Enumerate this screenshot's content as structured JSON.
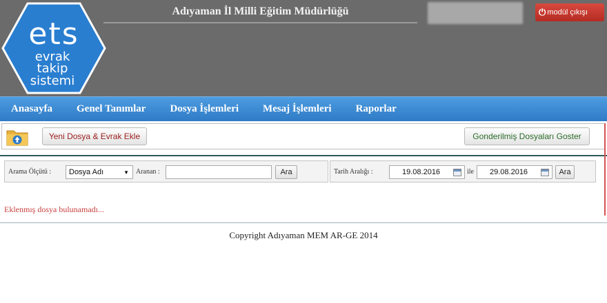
{
  "header": {
    "title": "Adıyaman İl Milli Eğitim Müdürlüğü",
    "logo_text": [
      "ets",
      "evrak",
      "takip",
      "sistemi"
    ],
    "exit_label": "modül çıkışı",
    "exit_icon": "power-icon"
  },
  "nav": {
    "items": [
      "Anasayfa",
      "Genel Tanımlar",
      "Dosya İşlemleri",
      "Mesaj İşlemleri",
      "Raporlar"
    ]
  },
  "toolbar": {
    "folder_icon": "folder-upload-icon",
    "add_label": "Yeni Dosya & Evrak Ekle",
    "sent_label": "Gonderilmiş Dosyaları Goster"
  },
  "search": {
    "criteria_label": "Arama Ölçütü :",
    "criteria_value": "Dosya Adı",
    "query_label": "Aranan :",
    "query_value": "",
    "search_button": "Ara"
  },
  "date_filter": {
    "label": "Tarih Aralığı :",
    "start": "19.08.2016",
    "between_label": "ile",
    "end": "29.08.2016",
    "button": "Ara"
  },
  "message": "Eklenmış dosya bulunamadı...",
  "footer": "Copyright Adıyaman MEM AR-GE 2014",
  "colors": {
    "header_bg": "#6b6b6b",
    "nav_bg": "#3a8ad4",
    "exit_bg": "#c9382f",
    "message": "#c94040"
  }
}
